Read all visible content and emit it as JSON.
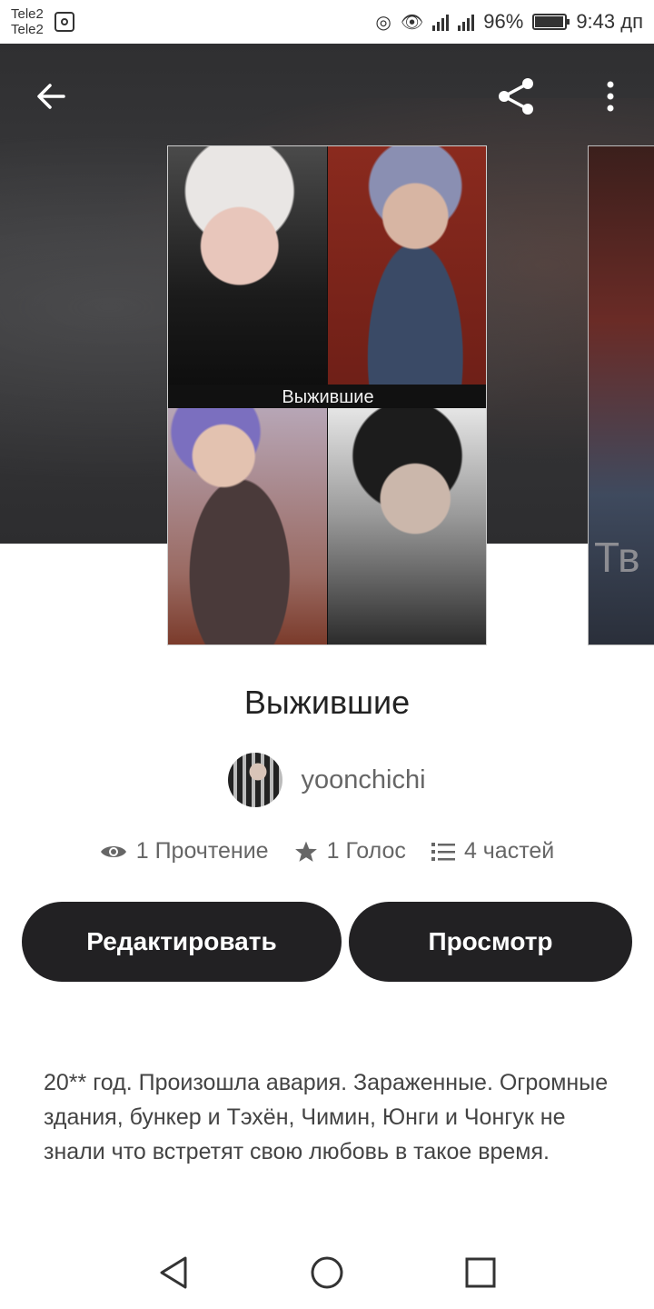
{
  "status_bar": {
    "carrier1": "Tele2",
    "carrier2": "Tele2",
    "battery": "96%",
    "battery_level": 0.96,
    "time": "9:43 дп"
  },
  "header": {
    "back_icon": "arrow-left-icon",
    "share_icon": "share-icon",
    "menu_icon": "more-vertical-icon"
  },
  "cover": {
    "label": "Выжившие",
    "next_cover_partial_text": "Тв"
  },
  "story": {
    "title": "Выжившие",
    "author": "yoonchichi",
    "stats": {
      "reads": "1 Прочтение",
      "votes": "1 Голос",
      "parts": "4 частей"
    },
    "description": "20** год. Произошла авария.  Зараженные. Огромные здания, бункер и Тэхён, Чимин, Юнги и Чонгук не знали что встретят свою любовь в такое время."
  },
  "actions": {
    "edit_label": "Редактировать",
    "view_label": "Просмотр"
  },
  "navbar": {
    "back_icon": "nav-back-icon",
    "home_icon": "nav-home-icon",
    "recents_icon": "nav-recents-icon"
  },
  "colors": {
    "button_bg": "#222123",
    "hero_bg": "#2f2f31"
  }
}
